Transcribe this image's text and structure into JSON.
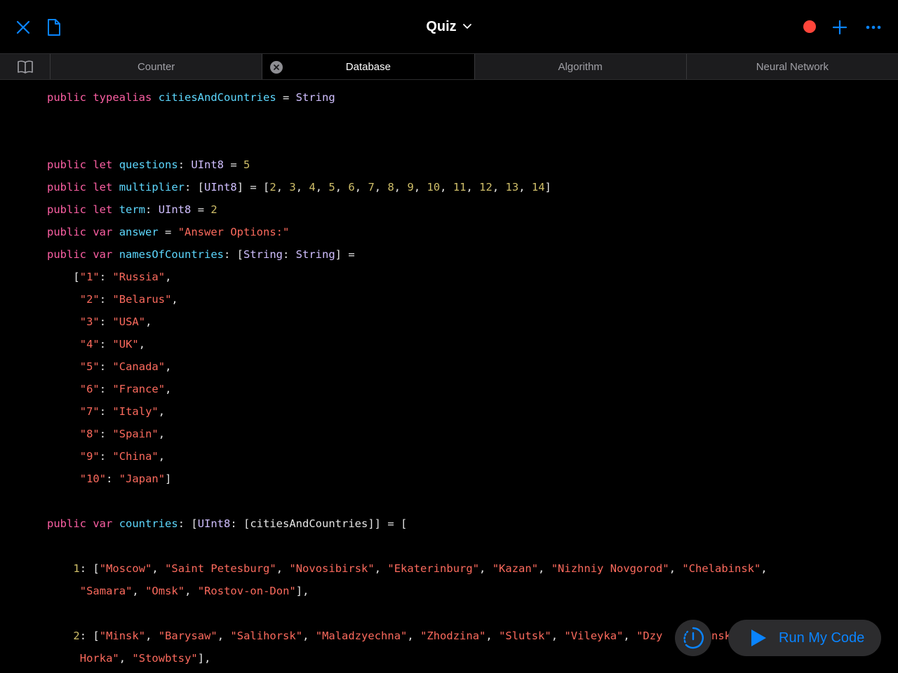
{
  "colors": {
    "accent": "#0a84ff",
    "record": "#ff453a",
    "keyword": "#fc5fa3",
    "identifier": "#5dd8ff",
    "type": "#d0bfff",
    "string": "#fc6a5d",
    "number": "#d0bf69",
    "plain": "#e6e6e6"
  },
  "header": {
    "title": "Quiz",
    "icons": {
      "close": "close-icon",
      "document": "document-icon",
      "title_chevron": "chevron-down-icon",
      "record": "record-icon",
      "add": "plus-icon",
      "more": "ellipsis-icon"
    }
  },
  "tabs": {
    "book_icon": "book-icon",
    "items": [
      {
        "label": "Counter",
        "active": false
      },
      {
        "label": "Database",
        "active": true,
        "closable": true
      },
      {
        "label": "Algorithm",
        "active": false
      },
      {
        "label": "Neural Network",
        "active": false
      }
    ]
  },
  "code": {
    "lines": [
      {
        "row": 0,
        "indent": 0,
        "tokens": [
          [
            "keyword",
            "public"
          ],
          [
            "plain",
            " "
          ],
          [
            "keyword",
            "typealias"
          ],
          [
            "plain",
            " "
          ],
          [
            "ident",
            "citiesAndCountries"
          ],
          [
            "plain",
            " = "
          ],
          [
            "type",
            "String"
          ]
        ]
      },
      {
        "row": 3,
        "indent": 0,
        "tokens": [
          [
            "keyword",
            "public"
          ],
          [
            "plain",
            " "
          ],
          [
            "keyword",
            "let"
          ],
          [
            "plain",
            " "
          ],
          [
            "ident",
            "questions"
          ],
          [
            "plain",
            ": "
          ],
          [
            "type",
            "UInt8"
          ],
          [
            "plain",
            " = "
          ],
          [
            "number",
            "5"
          ]
        ]
      },
      {
        "row": 4,
        "indent": 0,
        "tokens": [
          [
            "keyword",
            "public"
          ],
          [
            "plain",
            " "
          ],
          [
            "keyword",
            "let"
          ],
          [
            "plain",
            " "
          ],
          [
            "ident",
            "multiplier"
          ],
          [
            "plain",
            ": ["
          ],
          [
            "type",
            "UInt8"
          ],
          [
            "plain",
            "] = ["
          ],
          [
            "number",
            "2"
          ],
          [
            "plain",
            ", "
          ],
          [
            "number",
            "3"
          ],
          [
            "plain",
            ", "
          ],
          [
            "number",
            "4"
          ],
          [
            "plain",
            ", "
          ],
          [
            "number",
            "5"
          ],
          [
            "plain",
            ", "
          ],
          [
            "number",
            "6"
          ],
          [
            "plain",
            ", "
          ],
          [
            "number",
            "7"
          ],
          [
            "plain",
            ", "
          ],
          [
            "number",
            "8"
          ],
          [
            "plain",
            ", "
          ],
          [
            "number",
            "9"
          ],
          [
            "plain",
            ", "
          ],
          [
            "number",
            "10"
          ],
          [
            "plain",
            ", "
          ],
          [
            "number",
            "11"
          ],
          [
            "plain",
            ", "
          ],
          [
            "number",
            "12"
          ],
          [
            "plain",
            ", "
          ],
          [
            "number",
            "13"
          ],
          [
            "plain",
            ", "
          ],
          [
            "number",
            "14"
          ],
          [
            "plain",
            "]"
          ]
        ]
      },
      {
        "row": 5,
        "indent": 0,
        "tokens": [
          [
            "keyword",
            "public"
          ],
          [
            "plain",
            " "
          ],
          [
            "keyword",
            "let"
          ],
          [
            "plain",
            " "
          ],
          [
            "ident",
            "term"
          ],
          [
            "plain",
            ": "
          ],
          [
            "type",
            "UInt8"
          ],
          [
            "plain",
            " = "
          ],
          [
            "number",
            "2"
          ]
        ]
      },
      {
        "row": 6,
        "indent": 0,
        "tokens": [
          [
            "keyword",
            "public"
          ],
          [
            "plain",
            " "
          ],
          [
            "keyword",
            "var"
          ],
          [
            "plain",
            " "
          ],
          [
            "ident",
            "answer"
          ],
          [
            "plain",
            " = "
          ],
          [
            "string",
            "\"Answer Options:\""
          ]
        ]
      },
      {
        "row": 7,
        "indent": 0,
        "tokens": [
          [
            "keyword",
            "public"
          ],
          [
            "plain",
            " "
          ],
          [
            "keyword",
            "var"
          ],
          [
            "plain",
            " "
          ],
          [
            "ident",
            "namesOfCountries"
          ],
          [
            "plain",
            ": ["
          ],
          [
            "type",
            "String"
          ],
          [
            "plain",
            ": "
          ],
          [
            "type",
            "String"
          ],
          [
            "plain",
            "] ="
          ]
        ]
      },
      {
        "row": 8,
        "indent": 4,
        "tokens": [
          [
            "plain",
            "["
          ],
          [
            "string",
            "\"1\""
          ],
          [
            "plain",
            ": "
          ],
          [
            "string",
            "\"Russia\""
          ],
          [
            "plain",
            ","
          ]
        ]
      },
      {
        "row": 9,
        "indent": 5,
        "tokens": [
          [
            "string",
            "\"2\""
          ],
          [
            "plain",
            ": "
          ],
          [
            "string",
            "\"Belarus\""
          ],
          [
            "plain",
            ","
          ]
        ]
      },
      {
        "row": 10,
        "indent": 5,
        "tokens": [
          [
            "string",
            "\"3\""
          ],
          [
            "plain",
            ": "
          ],
          [
            "string",
            "\"USA\""
          ],
          [
            "plain",
            ","
          ]
        ]
      },
      {
        "row": 11,
        "indent": 5,
        "tokens": [
          [
            "string",
            "\"4\""
          ],
          [
            "plain",
            ": "
          ],
          [
            "string",
            "\"UK\""
          ],
          [
            "plain",
            ","
          ]
        ]
      },
      {
        "row": 12,
        "indent": 5,
        "tokens": [
          [
            "string",
            "\"5\""
          ],
          [
            "plain",
            ": "
          ],
          [
            "string",
            "\"Canada\""
          ],
          [
            "plain",
            ","
          ]
        ]
      },
      {
        "row": 13,
        "indent": 5,
        "tokens": [
          [
            "string",
            "\"6\""
          ],
          [
            "plain",
            ": "
          ],
          [
            "string",
            "\"France\""
          ],
          [
            "plain",
            ","
          ]
        ]
      },
      {
        "row": 14,
        "indent": 5,
        "tokens": [
          [
            "string",
            "\"7\""
          ],
          [
            "plain",
            ": "
          ],
          [
            "string",
            "\"Italy\""
          ],
          [
            "plain",
            ","
          ]
        ]
      },
      {
        "row": 15,
        "indent": 5,
        "tokens": [
          [
            "string",
            "\"8\""
          ],
          [
            "plain",
            ": "
          ],
          [
            "string",
            "\"Spain\""
          ],
          [
            "plain",
            ","
          ]
        ]
      },
      {
        "row": 16,
        "indent": 5,
        "tokens": [
          [
            "string",
            "\"9\""
          ],
          [
            "plain",
            ": "
          ],
          [
            "string",
            "\"China\""
          ],
          [
            "plain",
            ","
          ]
        ]
      },
      {
        "row": 17,
        "indent": 5,
        "tokens": [
          [
            "string",
            "\"10\""
          ],
          [
            "plain",
            ": "
          ],
          [
            "string",
            "\"Japan\""
          ],
          [
            "plain",
            "]"
          ]
        ]
      },
      {
        "row": 19,
        "indent": 0,
        "tokens": [
          [
            "keyword",
            "public"
          ],
          [
            "plain",
            " "
          ],
          [
            "keyword",
            "var"
          ],
          [
            "plain",
            " "
          ],
          [
            "ident",
            "countries"
          ],
          [
            "plain",
            ": ["
          ],
          [
            "type",
            "UInt8"
          ],
          [
            "plain",
            ": ["
          ],
          [
            "plain",
            "citiesAndCountries"
          ],
          [
            "plain",
            "]] = ["
          ]
        ]
      },
      {
        "row": 21,
        "indent": 4,
        "tokens": [
          [
            "number",
            "1"
          ],
          [
            "plain",
            ": ["
          ],
          [
            "string",
            "\"Moscow\""
          ],
          [
            "plain",
            ", "
          ],
          [
            "string",
            "\"Saint Petesburg\""
          ],
          [
            "plain",
            ", "
          ],
          [
            "string",
            "\"Novosibirsk\""
          ],
          [
            "plain",
            ", "
          ],
          [
            "string",
            "\"Ekaterinburg\""
          ],
          [
            "plain",
            ", "
          ],
          [
            "string",
            "\"Kazan\""
          ],
          [
            "plain",
            ", "
          ],
          [
            "string",
            "\"Nizhniy Novgorod\""
          ],
          [
            "plain",
            ", "
          ],
          [
            "string",
            "\"Chelabinsk\""
          ],
          [
            "plain",
            ","
          ]
        ]
      },
      {
        "row": 22,
        "indent": 5,
        "tokens": [
          [
            "string",
            "\"Samara\""
          ],
          [
            "plain",
            ", "
          ],
          [
            "string",
            "\"Omsk\""
          ],
          [
            "plain",
            ", "
          ],
          [
            "string",
            "\"Rostov-on-Don\""
          ],
          [
            "plain",
            "],"
          ]
        ]
      },
      {
        "row": 24,
        "indent": 4,
        "tokens": [
          [
            "number",
            "2"
          ],
          [
            "plain",
            ": ["
          ],
          [
            "string",
            "\"Minsk\""
          ],
          [
            "plain",
            ", "
          ],
          [
            "string",
            "\"Barysaw\""
          ],
          [
            "plain",
            ", "
          ],
          [
            "string",
            "\"Salihorsk\""
          ],
          [
            "plain",
            ", "
          ],
          [
            "string",
            "\"Maladzyechna\""
          ],
          [
            "plain",
            ", "
          ],
          [
            "string",
            "\"Zhodzina\""
          ],
          [
            "plain",
            ", "
          ],
          [
            "string",
            "\"Slutsk\""
          ],
          [
            "plain",
            ", "
          ],
          [
            "string",
            "\"Vileyka\""
          ],
          [
            "plain",
            ", "
          ],
          [
            "string",
            "\"Dzy"
          ]
        ]
      },
      {
        "row": 25,
        "indent": 5,
        "tokens": [
          [
            "string",
            "Horka\""
          ],
          [
            "plain",
            ", "
          ],
          [
            "string",
            "\"Stowbtsy\""
          ],
          [
            "plain",
            "],"
          ]
        ]
      }
    ],
    "hidden_fragment": "nsk"
  },
  "run": {
    "label": "Run My Code",
    "play_icon": "play-icon",
    "speed_icon": "speedometer-icon"
  }
}
